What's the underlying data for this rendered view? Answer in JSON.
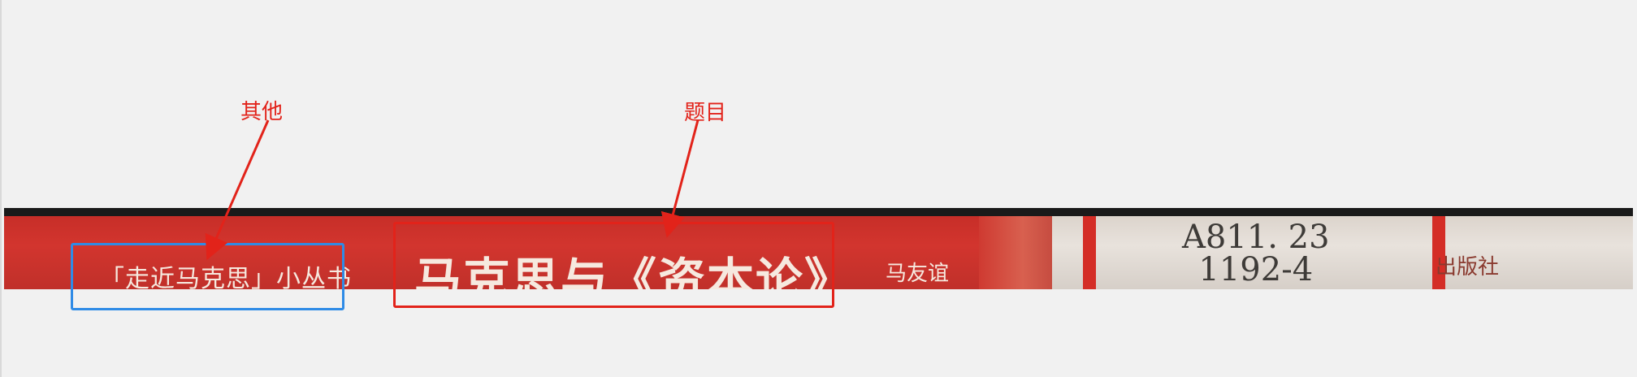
{
  "annotations": {
    "other_label": "其他",
    "title_label": "题目"
  },
  "spine": {
    "series": "「走近马克思」小丛书",
    "title": "马克思与《资本论》",
    "author": "马友谊",
    "call_number_line1": "A811. 23",
    "call_number_line2": "1192-4",
    "publisher": "出版社"
  },
  "colors": {
    "annotation_red": "#e2231a",
    "annotation_blue": "#2f8be6",
    "spine_red": "#d2352e"
  }
}
